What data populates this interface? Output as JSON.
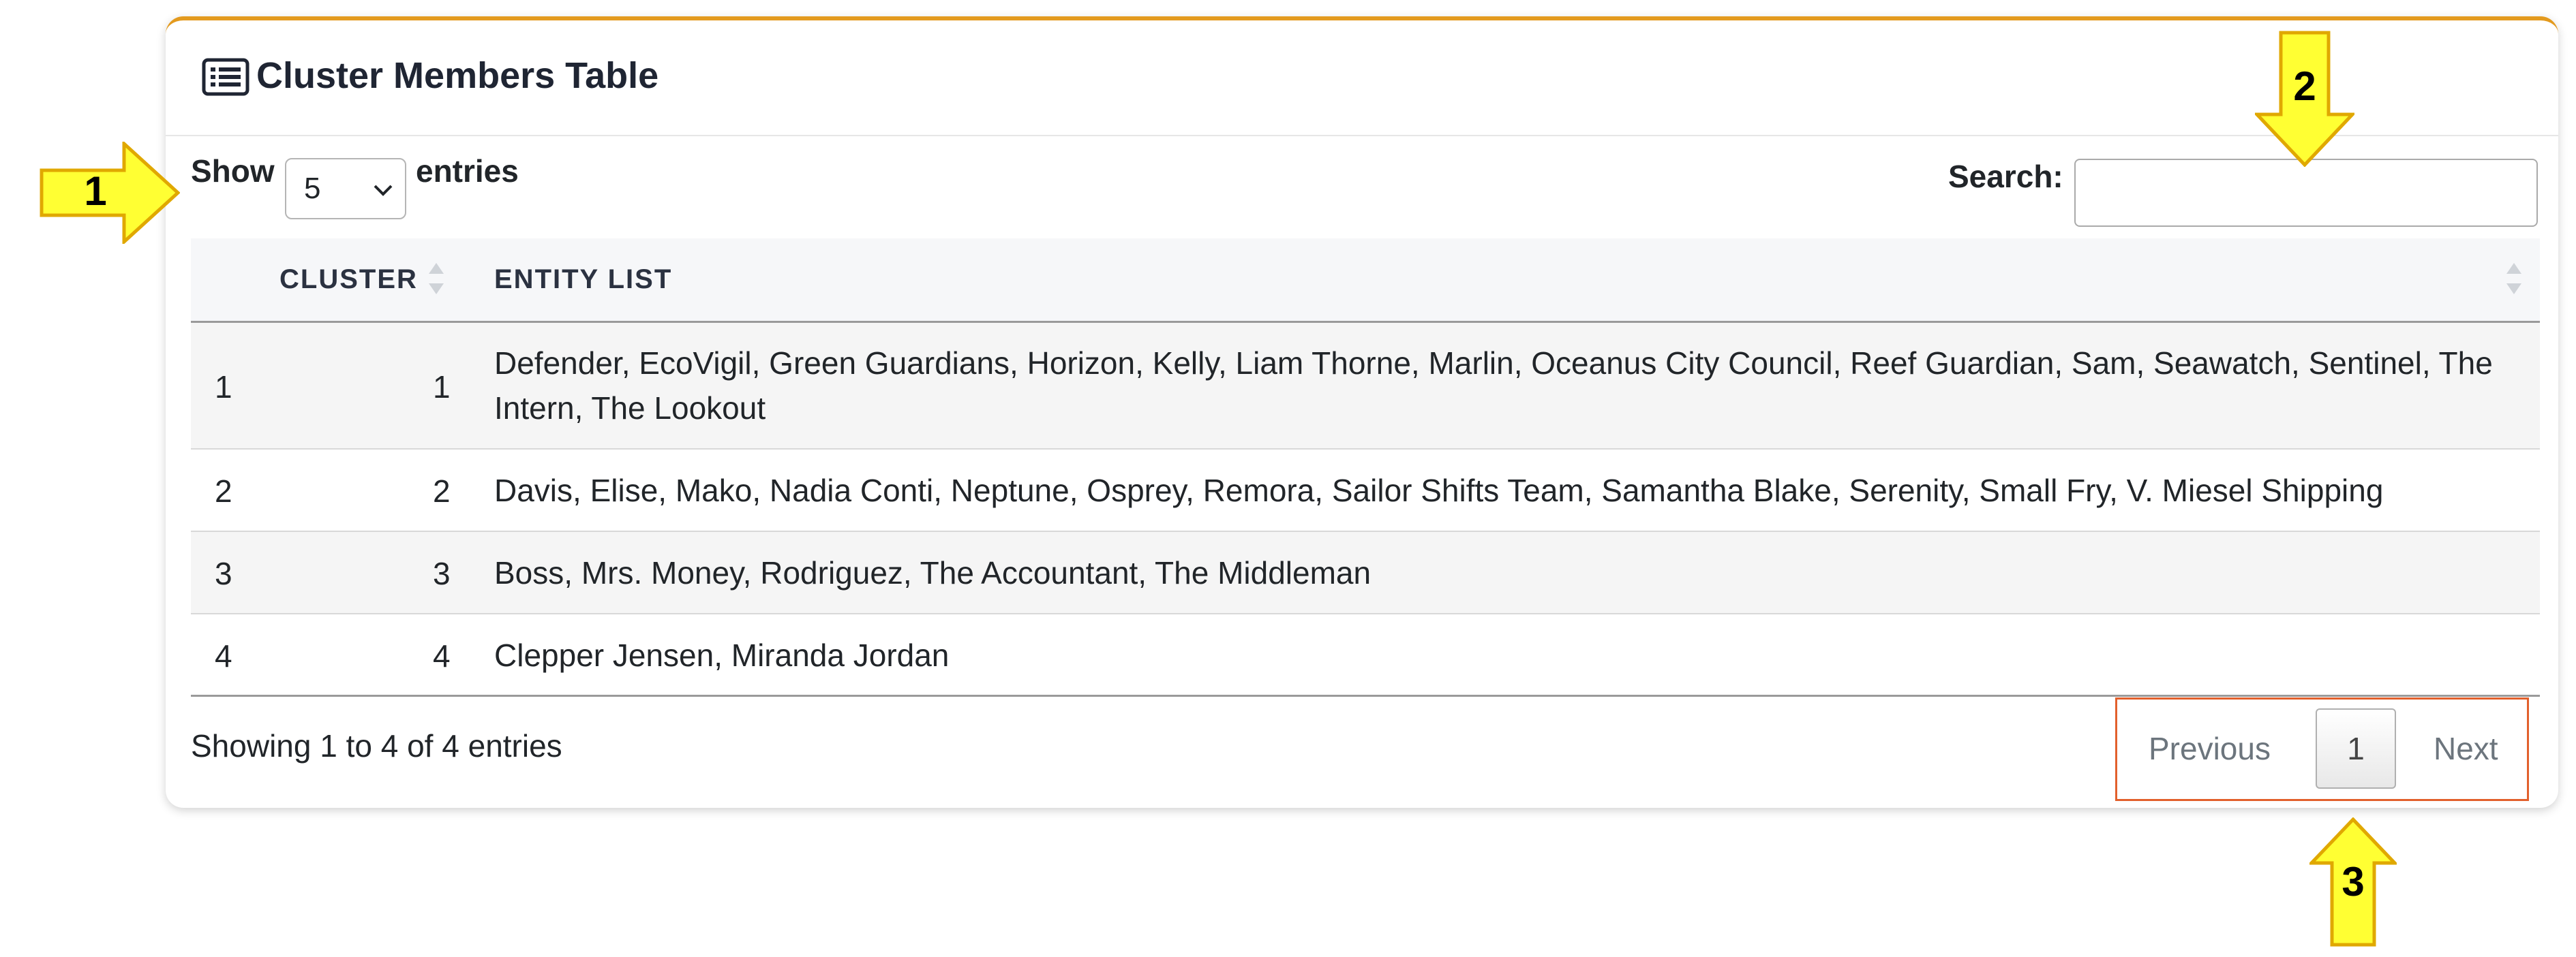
{
  "card": {
    "title": "Cluster Members Table",
    "accent_color": "#e39a1e"
  },
  "length_menu": {
    "show_label": "Show",
    "selected": "5",
    "entries_label": "entries"
  },
  "search": {
    "label": "Search:",
    "value": "",
    "placeholder": ""
  },
  "table": {
    "columns": [
      "CLUSTER",
      "ENTITY LIST"
    ],
    "rows": [
      {
        "index": "1",
        "cluster": "1",
        "entities": "Defender, EcoVigil, Green Guardians, Horizon, Kelly, Liam Thorne, Marlin, Oceanus City Council, Reef Guardian, Sam, Seawatch, Sentinel, The Intern, The Lookout"
      },
      {
        "index": "2",
        "cluster": "2",
        "entities": "Davis, Elise, Mako, Nadia Conti, Neptune, Osprey, Remora, Sailor Shifts Team, Samantha Blake, Serenity, Small Fry, V. Miesel Shipping"
      },
      {
        "index": "3",
        "cluster": "3",
        "entities": "Boss, Mrs. Money, Rodriguez, The Accountant, The Middleman"
      },
      {
        "index": "4",
        "cluster": "4",
        "entities": "Clepper Jensen, Miranda Jordan"
      }
    ]
  },
  "footer": {
    "info": "Showing 1 to 4 of 4 entries"
  },
  "pagination": {
    "previous": "Previous",
    "current": "1",
    "next": "Next",
    "highlight_color": "#e2602c"
  },
  "annotations": [
    {
      "label": "1",
      "color": "#ffff33"
    },
    {
      "label": "2",
      "color": "#ffff33"
    },
    {
      "label": "3",
      "color": "#ffff33"
    }
  ]
}
